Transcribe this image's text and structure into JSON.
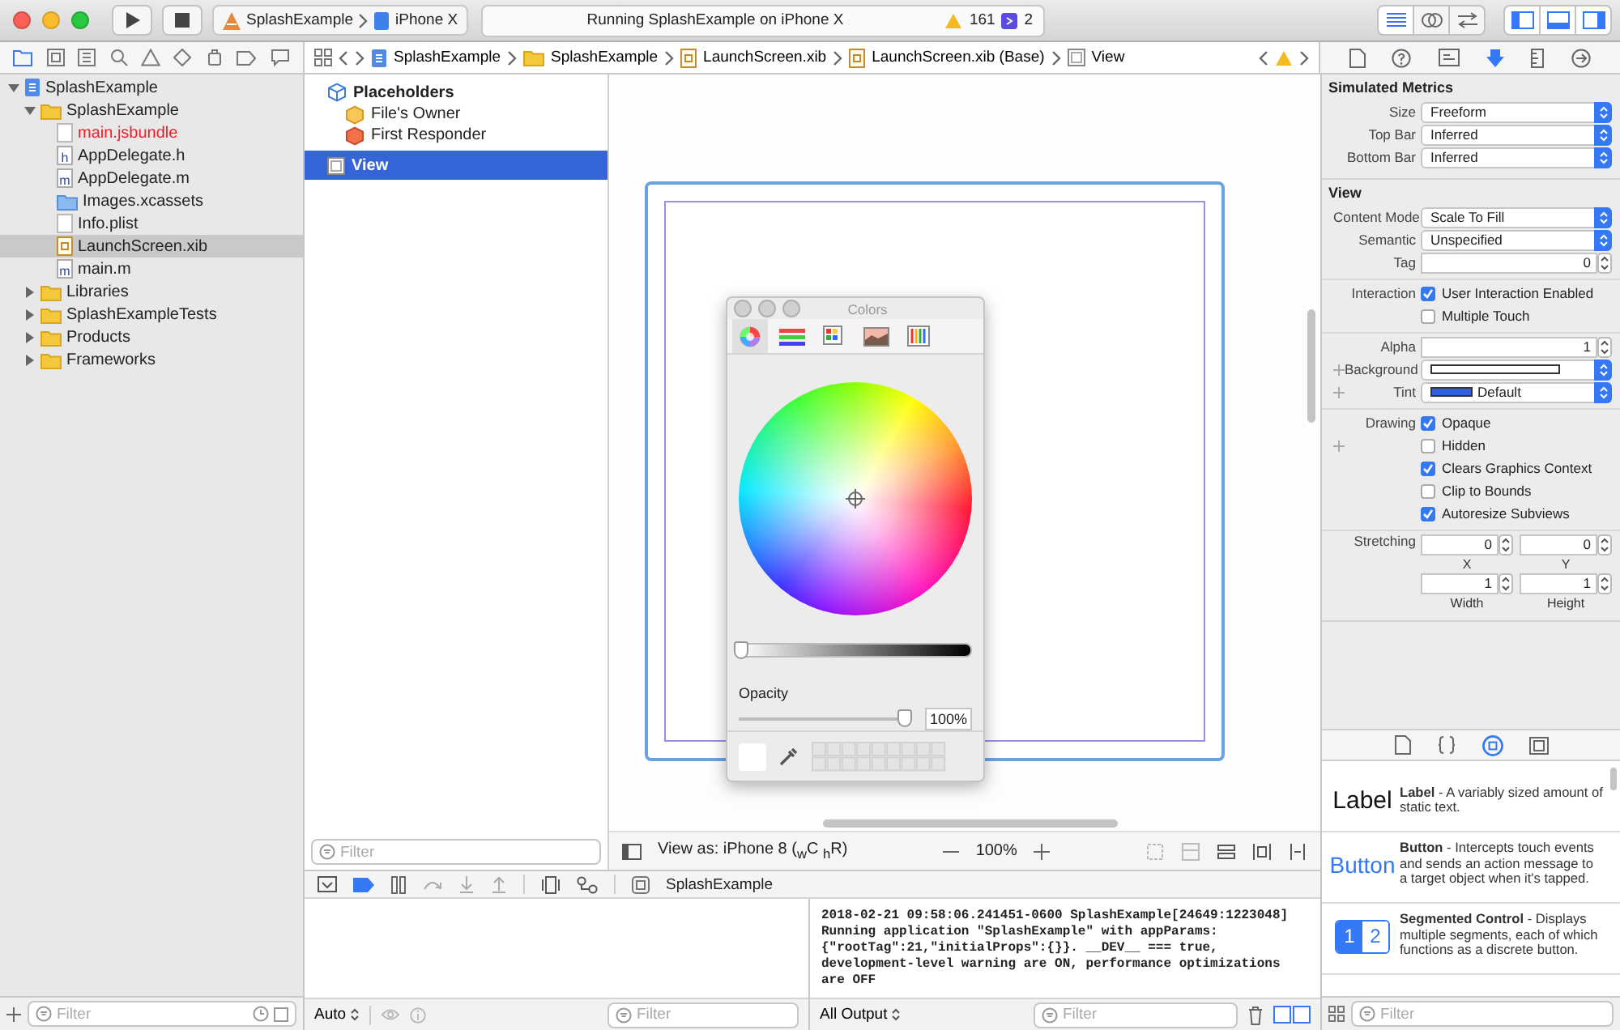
{
  "toolbar": {
    "scheme": "SplashExample",
    "device": "iPhone X",
    "status": "Running SplashExample on iPhone X",
    "warning_count": "161",
    "issue_count": "2",
    "editor_modes": [
      {
        "kind": "standard",
        "selected": true
      },
      {
        "kind": "assistant",
        "selected": false
      },
      {
        "kind": "version",
        "selected": false
      }
    ],
    "panels": [
      {
        "kind": "navigator",
        "on": true
      },
      {
        "kind": "debug",
        "on": true
      },
      {
        "kind": "utilities",
        "on": true
      }
    ]
  },
  "navigator": {
    "tabs": [
      {
        "kind": "project",
        "selected": true
      },
      {
        "kind": "source",
        "selected": false
      },
      {
        "kind": "symbol",
        "selected": false
      },
      {
        "kind": "find",
        "selected": false
      },
      {
        "kind": "issue",
        "selected": false
      },
      {
        "kind": "test",
        "selected": false
      },
      {
        "kind": "debug",
        "selected": false
      },
      {
        "kind": "breakpoint",
        "selected": false
      },
      {
        "kind": "report",
        "selected": false
      }
    ],
    "tree": [
      {
        "name": "SplashExample",
        "kind": "project",
        "expanded": true,
        "selected": false,
        "missing": false,
        "children": [
          {
            "name": "SplashExample",
            "kind": "folder",
            "expanded": true,
            "selected": false,
            "missing": false,
            "children": [
              {
                "name": "main.jsbundle",
                "kind": "doc",
                "selected": false,
                "missing": true
              },
              {
                "name": "AppDelegate.h",
                "kind": "source",
                "icon_letter": "h",
                "selected": false,
                "missing": false
              },
              {
                "name": "AppDelegate.m",
                "kind": "source",
                "icon_letter": "m",
                "selected": false,
                "missing": false
              },
              {
                "name": "Images.xcassets",
                "kind": "assets",
                "selected": false,
                "missing": false
              },
              {
                "name": "Info.plist",
                "kind": "doc",
                "selected": false,
                "missing": false
              },
              {
                "name": "LaunchScreen.xib",
                "kind": "xib",
                "selected": true,
                "missing": false
              },
              {
                "name": "main.m",
                "kind": "source",
                "icon_letter": "m",
                "selected": false,
                "missing": false
              }
            ]
          },
          {
            "name": "Libraries",
            "kind": "folder",
            "expanded": false,
            "selected": false,
            "missing": false
          },
          {
            "name": "SplashExampleTests",
            "kind": "folder",
            "expanded": false,
            "selected": false,
            "missing": false
          },
          {
            "name": "Products",
            "kind": "folder",
            "expanded": false,
            "selected": false,
            "missing": false
          },
          {
            "name": "Frameworks",
            "kind": "folder",
            "expanded": false,
            "selected": false,
            "missing": false
          }
        ]
      }
    ],
    "filter": {
      "placeholder": "Filter"
    }
  },
  "jump_bar": {
    "crumbs": [
      {
        "name": "SplashExample",
        "kind": "project"
      },
      {
        "name": "SplashExample",
        "kind": "folder"
      },
      {
        "name": "LaunchScreen.xib",
        "kind": "xib"
      },
      {
        "name": "LaunchScreen.xib (Base)",
        "kind": "xib"
      },
      {
        "name": "View",
        "kind": "view"
      }
    ]
  },
  "outline": {
    "group": {
      "title": "Placeholders",
      "items": [
        {
          "name": "File's Owner",
          "kind": "owner"
        },
        {
          "name": "First Responder",
          "kind": "responder"
        }
      ]
    },
    "items": [
      {
        "name": "View",
        "selected": true
      }
    ],
    "filter": {
      "placeholder": "Filter"
    }
  },
  "canvas": {
    "view_as": "View as: iPhone 8 ($_{w}$C $_{h}$R)",
    "zoom": "100%"
  },
  "colors_panel": {
    "title": "Colors",
    "tabs": [
      {
        "kind": "wheel",
        "selected": true
      },
      {
        "kind": "sliders",
        "selected": false
      },
      {
        "kind": "palettes",
        "selected": false
      },
      {
        "kind": "image",
        "selected": false
      },
      {
        "kind": "pencils",
        "selected": false
      }
    ],
    "brightness": {
      "level": 0
    },
    "opacity": {
      "label": "Opacity",
      "level": 1,
      "value": "100%"
    }
  },
  "debug": {
    "process": "SplashExample",
    "breakpoints_active": true,
    "variables": {
      "mode": "Auto",
      "filter": {
        "placeholder": "Filter"
      }
    },
    "console": {
      "text": "2018-02-21 09:58:06.241451-0600 SplashExample[24649:1223048]\nRunning application \"SplashExample\" with appParams:\n{\"rootTag\":21,\"initialProps\":{}}. __DEV__ === true,\ndevelopment-level warning are ON, performance optimizations\nare OFF",
      "output": "All Output",
      "filter": {
        "placeholder": "Filter"
      }
    }
  },
  "inspector": {
    "tabs": [
      {
        "kind": "file",
        "selected": false
      },
      {
        "kind": "help",
        "selected": false
      },
      {
        "kind": "identity",
        "selected": false
      },
      {
        "kind": "attributes",
        "selected": true
      },
      {
        "kind": "size",
        "selected": false
      },
      {
        "kind": "connections",
        "selected": false
      }
    ],
    "sections": [
      {
        "title": "Simulated Metrics",
        "groups": [
          [
            {
              "kind": "popup",
              "label": "Size",
              "value": "Freeform",
              "plus": false
            },
            {
              "kind": "popup",
              "label": "Top Bar",
              "value": "Inferred",
              "plus": false
            },
            {
              "kind": "popup",
              "label": "Bottom Bar",
              "value": "Inferred",
              "plus": false
            }
          ]
        ]
      },
      {
        "title": "View",
        "groups": [
          [
            {
              "kind": "popup",
              "label": "Content Mode",
              "value": "Scale To Fill",
              "plus": false
            },
            {
              "kind": "popup",
              "label": "Semantic",
              "value": "Unspecified",
              "plus": false
            },
            {
              "kind": "stepper",
              "label": "Tag",
              "value": "0",
              "plus": false
            }
          ],
          [
            {
              "kind": "check",
              "label": "Interaction",
              "text": "User Interaction Enabled",
              "checked": true,
              "plus": false
            },
            {
              "kind": "check",
              "text": "Multiple Touch",
              "checked": false,
              "plus": false
            }
          ],
          [
            {
              "kind": "stepper",
              "label": "Alpha",
              "value": "1",
              "plus": false
            },
            {
              "kind": "color",
              "label": "Background",
              "color": "#ffffff",
              "plus": true
            },
            {
              "kind": "color",
              "label": "Tint",
              "color": "#2f62e0",
              "value": "Default",
              "plus": true
            }
          ],
          [
            {
              "kind": "check",
              "label": "Drawing",
              "text": "Opaque",
              "checked": true,
              "plus": false
            },
            {
              "kind": "check",
              "text": "Hidden",
              "checked": false,
              "plus": true
            },
            {
              "kind": "check",
              "text": "Clears Graphics Context",
              "checked": true,
              "plus": false
            },
            {
              "kind": "check",
              "text": "Clip to Bounds",
              "checked": false,
              "plus": false
            },
            {
              "kind": "check",
              "text": "Autoresize Subviews",
              "checked": true,
              "plus": false
            }
          ],
          [
            {
              "kind": "pair",
              "label": "Stretching",
              "fields": [
                {
                  "value": "0",
                  "caption": "X"
                },
                {
                  "value": "0",
                  "caption": "Y"
                }
              ],
              "plus": false
            },
            {
              "kind": "pair",
              "fields": [
                {
                  "value": "1",
                  "caption": "Width"
                },
                {
                  "value": "1",
                  "caption": "Height"
                }
              ],
              "plus": false
            }
          ]
        ]
      }
    ]
  },
  "library": {
    "tabs": [
      {
        "kind": "file",
        "selected": false
      },
      {
        "kind": "code",
        "selected": false
      },
      {
        "kind": "object",
        "selected": true
      },
      {
        "kind": "media",
        "selected": false
      }
    ],
    "items": [
      {
        "kind": "label",
        "preview": "Label",
        "description": "**Label** - A variably sized amount of static text."
      },
      {
        "kind": "button",
        "preview": "Button",
        "description": "**Button** - Intercepts touch events and sends an action message to a target object when it's tapped."
      },
      {
        "kind": "segmented",
        "segments": [
          {
            "label": "1",
            "selected": true
          },
          {
            "label": "2",
            "selected": false
          }
        ],
        "description": "**Segmented Control** - Displays multiple segments, each of which functions as a discrete button."
      }
    ],
    "filter": {
      "placeholder": "Filter"
    }
  }
}
